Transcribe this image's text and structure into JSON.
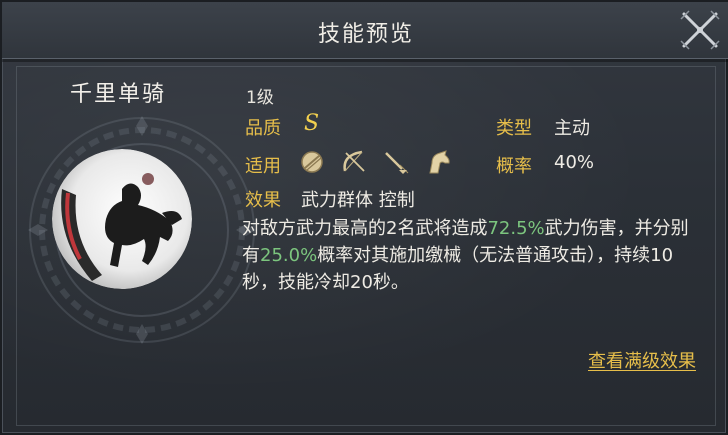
{
  "dialog": {
    "title": "技能预览",
    "close_icon": "crossed-swords-close-icon"
  },
  "skill": {
    "name": "千里单骑",
    "level": "1级",
    "quality_label": "品质",
    "quality_value": "S",
    "type_label": "类型",
    "type_value": "主动",
    "applies_label": "适用",
    "applies_icons": [
      "shield-icon",
      "bow-icon",
      "spear-icon",
      "horse-icon"
    ],
    "chance_label": "概率",
    "chance_value": "40%",
    "effect_label": "效果",
    "effect_tags": "武力群体 控制",
    "description": {
      "p1": "对敌方武力最高的2名武将造成",
      "v1": "72.5%",
      "p2": "武力伤害，并分别有",
      "v2": "25.0%",
      "p3": "概率对其施加缴械（无法普通攻击），持续10秒，技能冷却20秒。"
    },
    "portrait_icon": "horseman-portrait-icon"
  },
  "footer": {
    "view_max_level": "查看满级效果"
  },
  "colors": {
    "label_gold": "#e6be4a",
    "highlight_green": "#7cc57e",
    "grade_yellow": "#f2d04f"
  }
}
